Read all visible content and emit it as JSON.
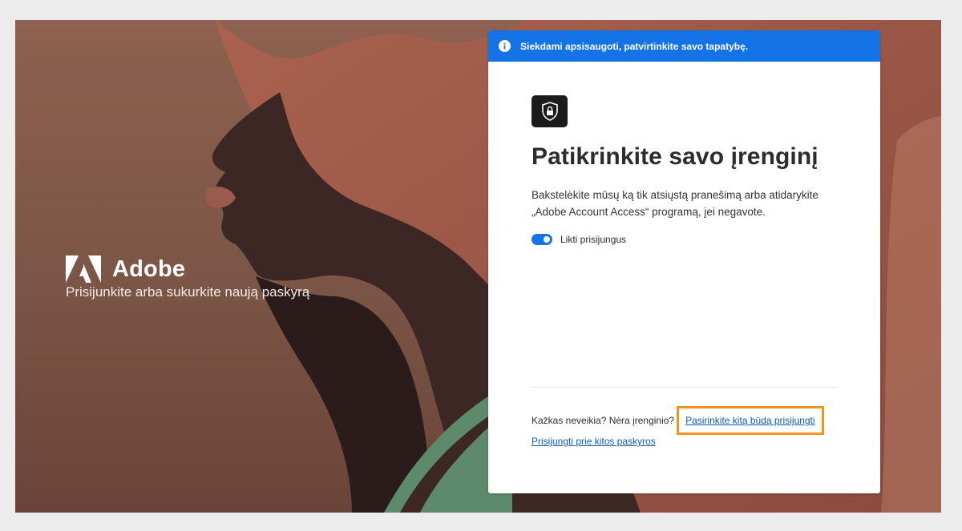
{
  "brand": {
    "name": "Adobe",
    "tagline": "Prisijunkite arba sukurkite naują paskyrą"
  },
  "banner": {
    "icon": "info-icon",
    "text": "Siekdami apsisaugoti, patvirtinkite savo tapatybę."
  },
  "card": {
    "icon": "shield-lock-icon",
    "title": "Patikrinkite savo įrenginį",
    "description": "Bakstelėkite mūsų ką tik atsiųstą pranešimą arba atidarykite „Adobe Account Access“ programą, jei negavote.",
    "stay_signed_in": {
      "label": "Likti prisijungus",
      "on": true
    },
    "help_text": "Kažkas neveikia? Nėra įrenginio?",
    "alt_method_link": "Pasirinkite kitą būdą prisijungti",
    "other_account_link": "Prisijungti prie kitos paskyros"
  },
  "colors": {
    "accent": "#1473e6",
    "link": "#0d5cb8",
    "highlight": "#f29422",
    "background_art": "#7a4a3c"
  }
}
